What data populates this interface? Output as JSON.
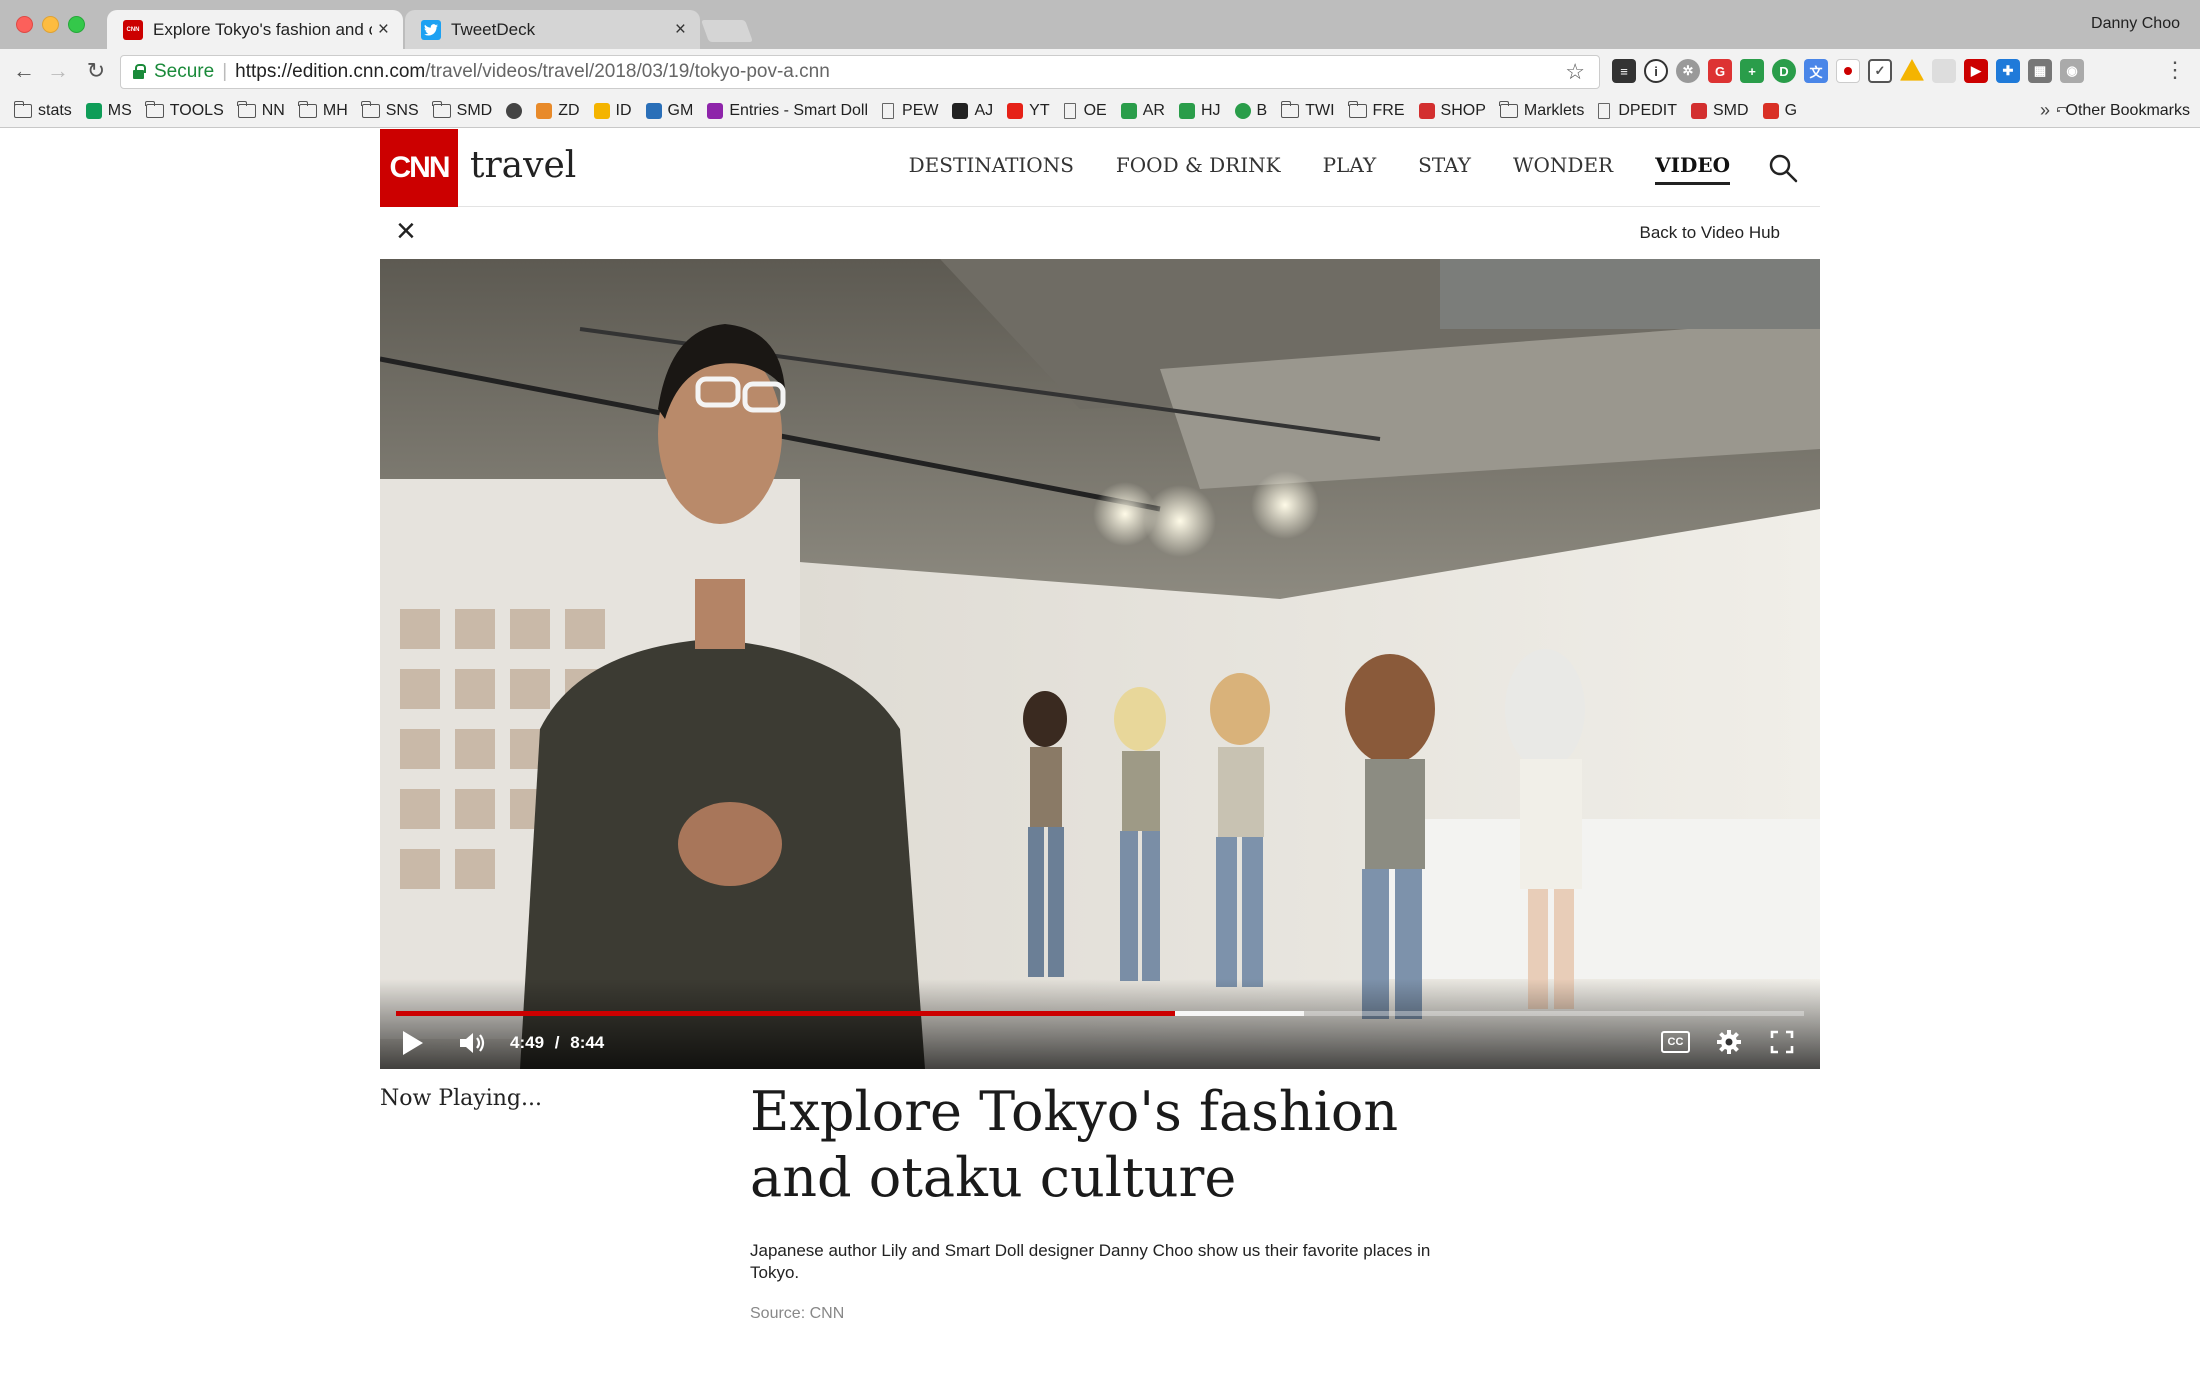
{
  "browser": {
    "tabs": [
      {
        "title": "Explore Tokyo's fashion and ot",
        "active": true,
        "favicon": "cnn-favicon"
      },
      {
        "title": "TweetDeck",
        "active": false,
        "favicon": "twitter-favicon"
      }
    ],
    "profile_name": "Danny Choo",
    "address_bar": {
      "secure_label": "Secure",
      "url_domain": "https://edition.cnn.com",
      "url_path": "/travel/videos/travel/2018/03/19/tokyo-pov-a.cnn"
    },
    "bookmarks": [
      {
        "label": "stats",
        "icon": "folder"
      },
      {
        "label": "MS",
        "icon": "sheet"
      },
      {
        "label": "TOOLS",
        "icon": "folder"
      },
      {
        "label": "NN",
        "icon": "folder"
      },
      {
        "label": "MH",
        "icon": "folder"
      },
      {
        "label": "SNS",
        "icon": "folder"
      },
      {
        "label": "SMD",
        "icon": "folder"
      },
      {
        "label": "",
        "icon": "cloud"
      },
      {
        "label": "ZD",
        "icon": "character"
      },
      {
        "label": "ID",
        "icon": "drive"
      },
      {
        "label": "GM",
        "icon": "swirl"
      },
      {
        "label": "Entries - Smart Doll",
        "icon": "purple-square"
      },
      {
        "label": "PEW",
        "icon": "page"
      },
      {
        "label": "AJ",
        "icon": "amazon"
      },
      {
        "label": "YT",
        "icon": "youtube"
      },
      {
        "label": "OE",
        "icon": "page"
      },
      {
        "label": "AR",
        "icon": "arrows"
      },
      {
        "label": "HJ",
        "icon": "green-square"
      },
      {
        "label": "B",
        "icon": "green-circle"
      },
      {
        "label": "TWI",
        "icon": "folder"
      },
      {
        "label": "FRE",
        "icon": "folder"
      },
      {
        "label": "SHOP",
        "icon": "red-square"
      },
      {
        "label": "Marklets",
        "icon": "folder"
      },
      {
        "label": "DPEDIT",
        "icon": "page"
      },
      {
        "label": "SMD",
        "icon": "red-square"
      },
      {
        "label": "G",
        "icon": "gmail"
      }
    ],
    "bookmarks_overflow": "»",
    "other_bookmarks": "Other Bookmarks",
    "colors": {
      "chrome": "#f2f2f2",
      "tabstrip": "#bdbdbd",
      "secure": "#1a8a3a"
    }
  },
  "site": {
    "logo_text": "CNN",
    "section": "travel",
    "nav": [
      {
        "label": "DESTINATIONS",
        "active": false
      },
      {
        "label": "FOOD & DRINK",
        "active": false
      },
      {
        "label": "PLAY",
        "active": false
      },
      {
        "label": "STAY",
        "active": false
      },
      {
        "label": "WONDER",
        "active": false
      },
      {
        "label": "VIDEO",
        "active": true
      }
    ],
    "back_link": "Back to Video Hub",
    "colors": {
      "brand": "#cc0000"
    }
  },
  "player": {
    "current_time": "4:49",
    "separator": "/",
    "duration": "8:44",
    "played_fraction": 0.553,
    "buffered_fraction": 0.645,
    "cc_label": "CC",
    "colors": {
      "progress": "#cc0000"
    }
  },
  "video": {
    "now_playing_label": "Now Playing...",
    "title": "Explore Tokyo's fashion and otaku culture",
    "description": "Japanese author Lily and Smart Doll designer Danny Choo show us their favorite places in Tokyo.",
    "source": "Source: CNN"
  }
}
